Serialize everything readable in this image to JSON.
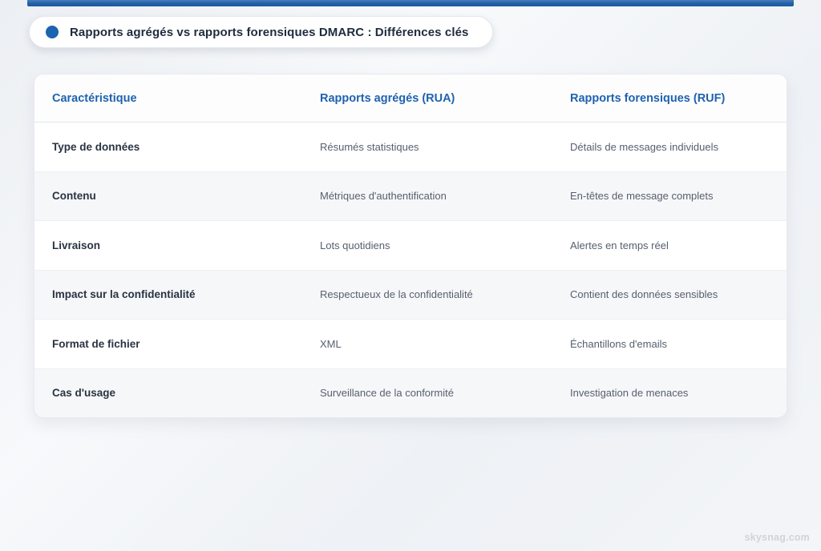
{
  "header": {
    "title": "Rapports agrégés vs rapports forensiques DMARC : Différences clés"
  },
  "table": {
    "columns": [
      "Caractéristique",
      "Rapports agrégés (RUA)",
      "Rapports forensiques (RUF)"
    ],
    "rows": [
      {
        "feature": "Type de données",
        "rua": "Résumés statistiques",
        "ruf": "Détails de messages individuels"
      },
      {
        "feature": "Contenu",
        "rua": "Métriques d'authentification",
        "ruf": "En-têtes de message complets"
      },
      {
        "feature": "Livraison",
        "rua": "Lots quotidiens",
        "ruf": "Alertes en temps réel"
      },
      {
        "feature": "Impact sur la confidentialité",
        "rua": "Respectueux de la confidentialité",
        "ruf": "Contient des données sensibles"
      },
      {
        "feature": "Format de fichier",
        "rua": "XML",
        "ruf": "Échantillons d'emails"
      },
      {
        "feature": "Cas d'usage",
        "rua": "Surveillance de la conformité",
        "ruf": "Investigation de menaces"
      }
    ]
  },
  "footer": {
    "watermark": "skysnag.com"
  },
  "colors": {
    "accent_bar": "#1f5fa6",
    "title_dot": "#1c63b0",
    "header_text": "#1f62ae",
    "stripe": "#f6f7f9"
  }
}
